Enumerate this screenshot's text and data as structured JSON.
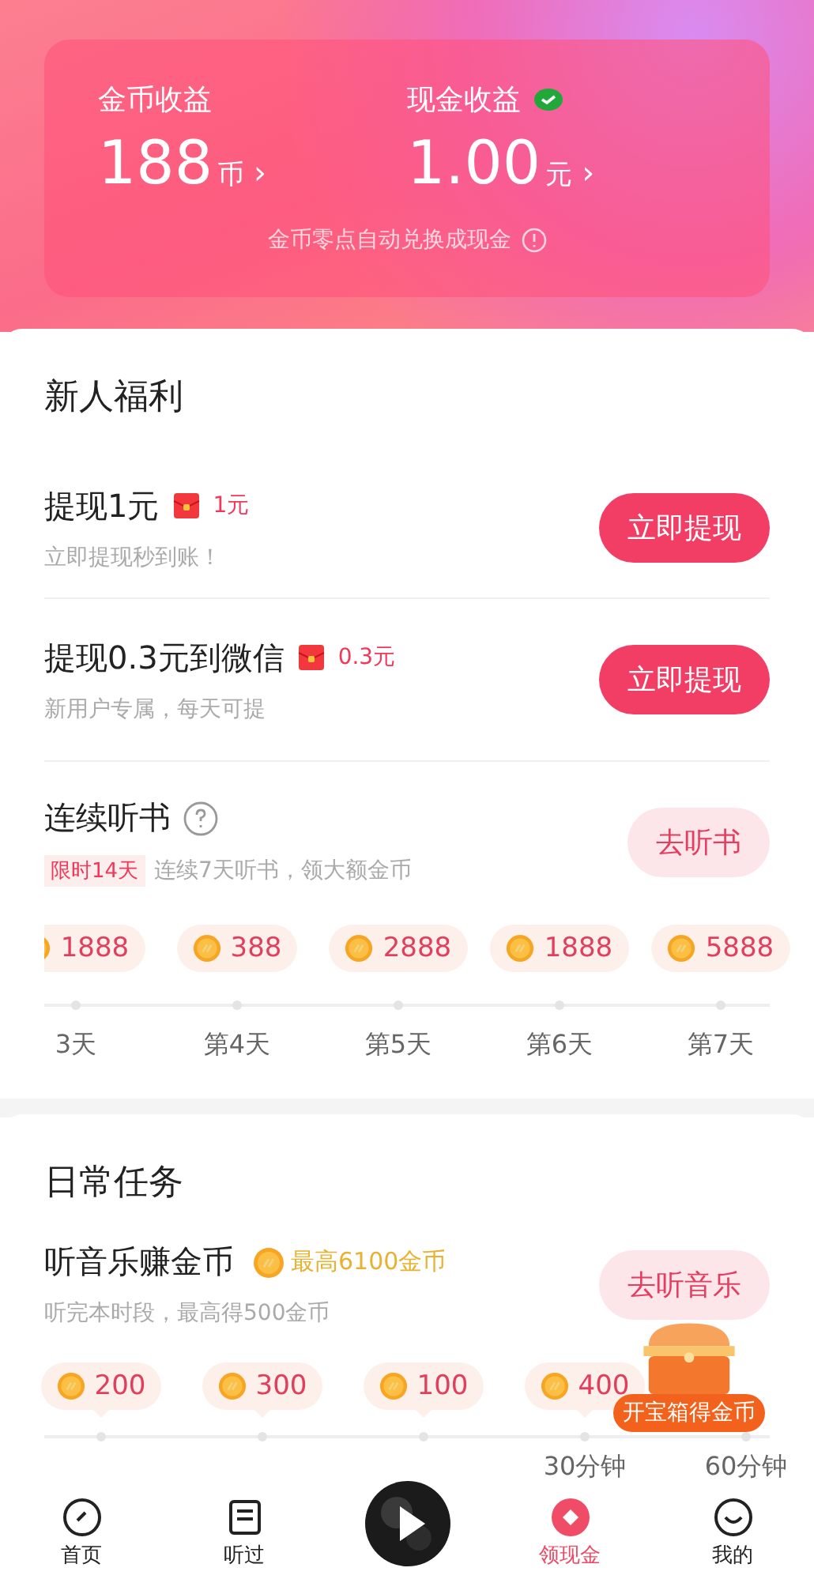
{
  "earnings": {
    "coins": {
      "label": "金币收益",
      "value": "188",
      "unit": "币",
      "chevron": "›"
    },
    "cash": {
      "label": "现金收益",
      "verified": true,
      "value": "1.00",
      "unit": "元",
      "chevron": "›"
    },
    "note": "金币零点自动兑换成现金"
  },
  "new_user": {
    "title": "新人福利",
    "items": [
      {
        "title": "提现1元",
        "badge": "1元",
        "subtitle": "立即提现秒到账！",
        "button": "立即提现"
      },
      {
        "title": "提现0.3元到微信",
        "badge": "0.3元",
        "subtitle": "新用户专属，每天可提",
        "button": "立即提现"
      }
    ]
  },
  "streak": {
    "title": "连续听书",
    "tag": "限时14天",
    "subtitle": "连续7天听书，领大额金币",
    "button": "去听书",
    "days": [
      {
        "reward": "1888",
        "label": "3天"
      },
      {
        "reward": "388",
        "label": "第4天"
      },
      {
        "reward": "2888",
        "label": "第5天"
      },
      {
        "reward": "1888",
        "label": "第6天"
      },
      {
        "reward": "5888",
        "label": "第7天"
      }
    ]
  },
  "daily": {
    "title": "日常任务",
    "task": {
      "title": "听音乐赚金币",
      "reward": "最高6100金币",
      "subtitle": "听完本时段，最高得500金币",
      "button": "去听音乐",
      "slots": [
        {
          "reward": "200"
        },
        {
          "reward": "300"
        },
        {
          "reward": "100"
        },
        {
          "reward": "400",
          "label": "30分钟"
        },
        {
          "label": "60分钟"
        }
      ]
    }
  },
  "treasure": {
    "label": "开宝箱得金币"
  },
  "nav": [
    {
      "kind": "home",
      "label": "首页",
      "selected": false
    },
    {
      "kind": "history",
      "label": "听过",
      "selected": false
    },
    {
      "kind": "player"
    },
    {
      "kind": "cash",
      "label": "领现金",
      "selected": true
    },
    {
      "kind": "me",
      "label": "我的",
      "selected": false
    }
  ]
}
